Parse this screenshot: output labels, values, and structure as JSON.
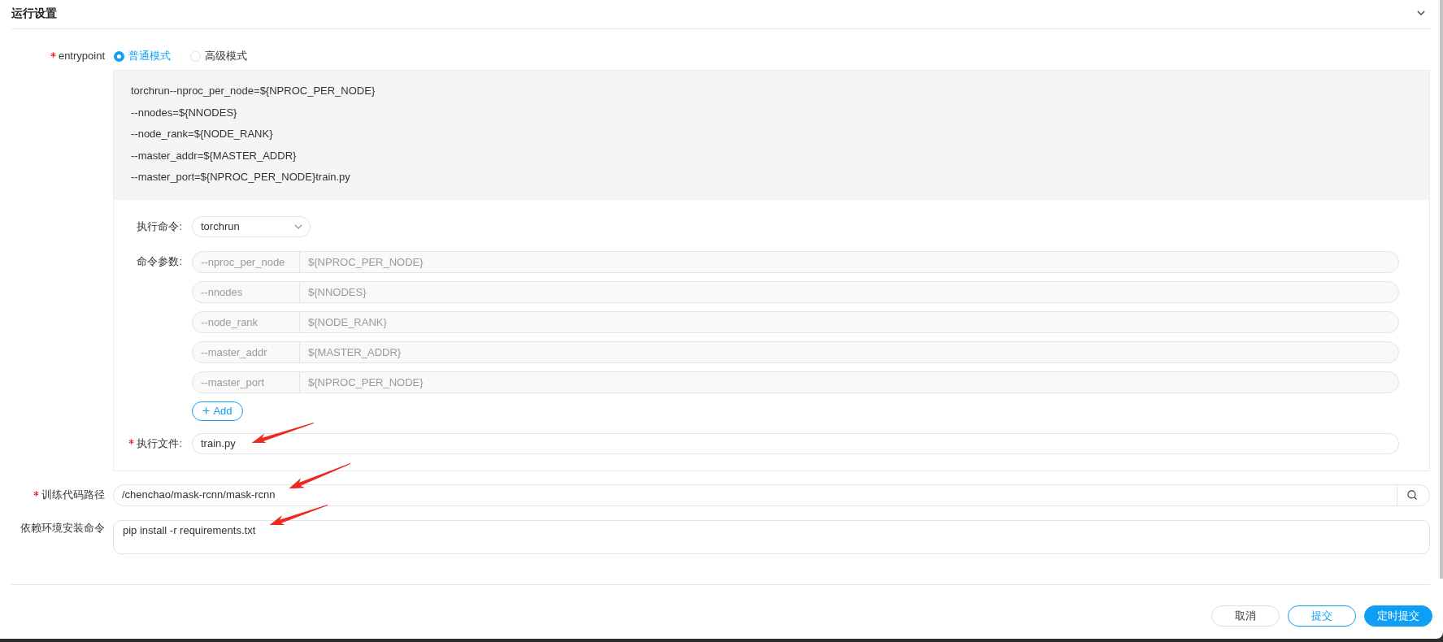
{
  "section": {
    "title": "运行设置"
  },
  "entrypoint": {
    "label": "entrypoint",
    "required": true,
    "modes": [
      {
        "label": "普通模式",
        "selected": true
      },
      {
        "label": "高级模式",
        "selected": false
      }
    ],
    "preview_lines": [
      "torchrun--nproc_per_node=${NPROC_PER_NODE}",
      "--nnodes=${NNODES}",
      "--node_rank=${NODE_RANK}",
      "--master_addr=${MASTER_ADDR}",
      "--master_port=${NPROC_PER_NODE}train.py"
    ],
    "command": {
      "label": "执行命令:",
      "value": "torchrun"
    },
    "arguments": {
      "label": "命令参数:",
      "rows": [
        {
          "key": "--nproc_per_node",
          "value": "${NPROC_PER_NODE}",
          "disabled": true
        },
        {
          "key": "--nnodes",
          "value": "${NNODES}",
          "disabled": true
        },
        {
          "key": "--node_rank",
          "value": "${NODE_RANK}",
          "disabled": true
        },
        {
          "key": "--master_addr",
          "value": "${MASTER_ADDR}",
          "disabled": true
        },
        {
          "key": "--master_port",
          "value": "${NPROC_PER_NODE}",
          "disabled": true
        }
      ]
    },
    "add_button": {
      "label": "Add"
    },
    "exec_file": {
      "label": "执行文件:",
      "required": true,
      "value": "train.py"
    }
  },
  "code_path": {
    "label": "训练代码路径",
    "required": true,
    "value": "/chenchao/mask-rcnn/mask-rcnn"
  },
  "install_command": {
    "label": "依赖环境安装命令",
    "value": "pip install -r requirements.txt"
  },
  "footer_buttons": [
    {
      "label": "取消",
      "kind": "default"
    },
    {
      "label": "提交",
      "kind": "outline"
    },
    {
      "label": "定时提交",
      "kind": "primary"
    }
  ]
}
